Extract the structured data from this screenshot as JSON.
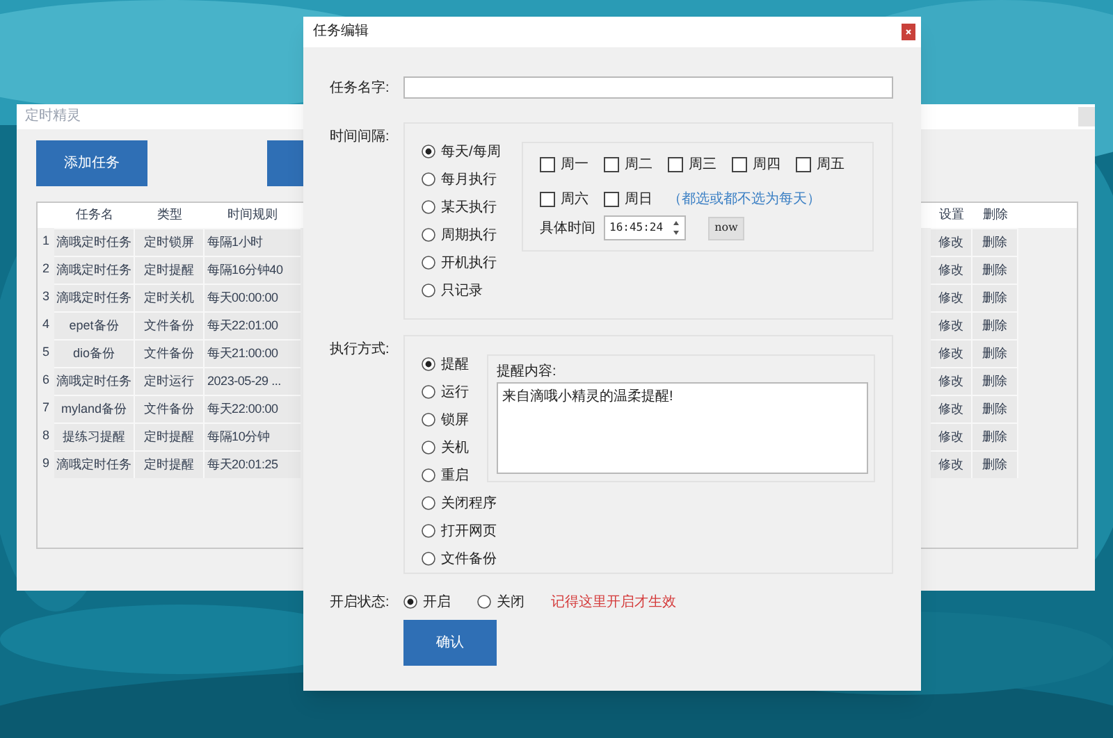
{
  "back_window": {
    "title": "定时精灵",
    "add_button": "添加任务",
    "table": {
      "columns": [
        "任务名",
        "类型",
        "时间规则"
      ],
      "right_columns": [
        "设置",
        "删除"
      ],
      "rows": [
        {
          "index": "1",
          "name": "滴哦定时任务",
          "type": "定时锁屏",
          "rule": "每隔1小时",
          "edit": "修改",
          "delete": "删除"
        },
        {
          "index": "2",
          "name": "滴哦定时任务",
          "type": "定时提醒",
          "rule": "每隔16分钟40",
          "edit": "修改",
          "delete": "删除"
        },
        {
          "index": "3",
          "name": "滴哦定时任务",
          "type": "定时关机",
          "rule": "每天00:00:00",
          "edit": "修改",
          "delete": "删除"
        },
        {
          "index": "4",
          "name": "epet备份",
          "type": "文件备份",
          "rule": "每天22:01:00",
          "edit": "修改",
          "delete": "删除"
        },
        {
          "index": "5",
          "name": "dio备份",
          "type": "文件备份",
          "rule": "每天21:00:00",
          "edit": "修改",
          "delete": "删除"
        },
        {
          "index": "6",
          "name": "滴哦定时任务",
          "type": "定时运行",
          "rule": "2023-05-29 ...",
          "edit": "修改",
          "delete": "删除"
        },
        {
          "index": "7",
          "name": "myland备份",
          "type": "文件备份",
          "rule": "每天22:00:00",
          "edit": "修改",
          "delete": "删除"
        },
        {
          "index": "8",
          "name": "提练习提醒",
          "type": "定时提醒",
          "rule": "每隔10分钟",
          "edit": "修改",
          "delete": "删除"
        },
        {
          "index": "9",
          "name": "滴哦定时任务",
          "type": "定时提醒",
          "rule": "每天20:01:25",
          "edit": "修改",
          "delete": "删除"
        }
      ]
    }
  },
  "dialog": {
    "title": "任务编辑",
    "name_label": "任务名字:",
    "interval": {
      "label": "时间间隔:",
      "options": [
        {
          "label": "每天/每周",
          "selected": true
        },
        {
          "label": "每月执行",
          "selected": false
        },
        {
          "label": "某天执行",
          "selected": false
        },
        {
          "label": "周期执行",
          "selected": false
        },
        {
          "label": "开机执行",
          "selected": false
        },
        {
          "label": "只记录",
          "selected": false
        }
      ],
      "weekdays": [
        {
          "label": "周一",
          "checked": false
        },
        {
          "label": "周二",
          "checked": false
        },
        {
          "label": "周三",
          "checked": false
        },
        {
          "label": "周四",
          "checked": false
        },
        {
          "label": "周五",
          "checked": false
        },
        {
          "label": "周六",
          "checked": false
        },
        {
          "label": "周日",
          "checked": false
        }
      ],
      "hint": "（都选或都不选为每天）",
      "time_label": "具体时间",
      "time": "16:45:24",
      "now_button": "now"
    },
    "execution": {
      "label": "执行方式:",
      "options": [
        {
          "label": "提醒",
          "selected": true
        },
        {
          "label": "运行",
          "selected": false
        },
        {
          "label": "锁屏",
          "selected": false
        },
        {
          "label": "关机",
          "selected": false
        },
        {
          "label": "重启",
          "selected": false
        },
        {
          "label": "关闭程序",
          "selected": false
        },
        {
          "label": "打开网页",
          "selected": false
        },
        {
          "label": "文件备份",
          "selected": false
        }
      ],
      "content_label": "提醒内容:",
      "content": "来自滴哦小精灵的温柔提醒!"
    },
    "status": {
      "label": "开启状态:",
      "options": [
        {
          "label": "开启",
          "selected": true
        },
        {
          "label": "关闭",
          "selected": false
        }
      ],
      "note": "记得这里开启才生效"
    },
    "confirm_button": "确认"
  }
}
